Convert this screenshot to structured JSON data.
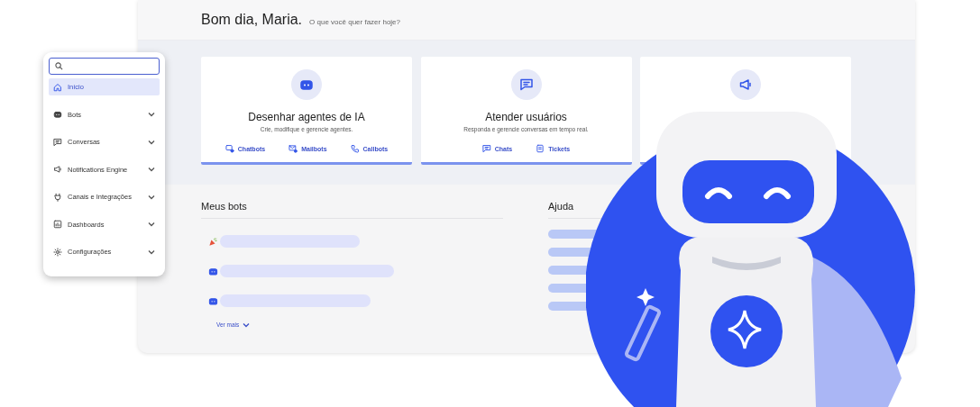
{
  "greeting": {
    "title": "Bom dia, Maria.",
    "subtitle": "O que você quer fazer hoje?"
  },
  "sidebar": {
    "items": [
      {
        "kind": "home",
        "label": "Início",
        "selected": true,
        "expandable": false
      },
      {
        "kind": "bot",
        "label": "Bots",
        "selected": false,
        "expandable": true
      },
      {
        "kind": "chat",
        "label": "Conversas",
        "selected": false,
        "expandable": true
      },
      {
        "kind": "megaphone",
        "label": "Notifications Engine",
        "selected": false,
        "expandable": true
      },
      {
        "kind": "plug",
        "label": "Canais e Integrações",
        "selected": false,
        "expandable": true
      },
      {
        "kind": "dashboard",
        "label": "Dashboards",
        "selected": false,
        "expandable": true
      },
      {
        "kind": "gear",
        "label": "Configurações",
        "selected": false,
        "expandable": true
      }
    ]
  },
  "cards": [
    {
      "kind": "bot",
      "title": "Desenhar agentes de IA",
      "subtitle": "Crie, modifique e gerencie agentes.",
      "links": [
        {
          "kind": "chatbot",
          "label": "Chatbots"
        },
        {
          "kind": "mail",
          "label": "Mailbots"
        },
        {
          "kind": "phone",
          "label": "Callbots"
        }
      ]
    },
    {
      "kind": "chat",
      "title": "Atender usuários",
      "subtitle": "Responda e gerencie conversas em tempo real.",
      "links": [
        {
          "kind": "chat",
          "label": "Chats"
        },
        {
          "kind": "ticket",
          "label": "Tickets"
        }
      ]
    },
    {
      "kind": "megaphone"
    }
  ],
  "my_bots": {
    "title": "Meus bots",
    "items": [
      {
        "kind": "party"
      },
      {
        "kind": "bot"
      },
      {
        "kind": "bot"
      }
    ],
    "more": "Ver mais"
  },
  "help": {
    "title": "Ajuda",
    "items": [
      {
        "kind": "placeholder"
      },
      {
        "kind": "placeholder"
      },
      {
        "kind": "placeholder"
      },
      {
        "kind": "placeholder"
      },
      {
        "kind": "placeholder"
      }
    ]
  }
}
